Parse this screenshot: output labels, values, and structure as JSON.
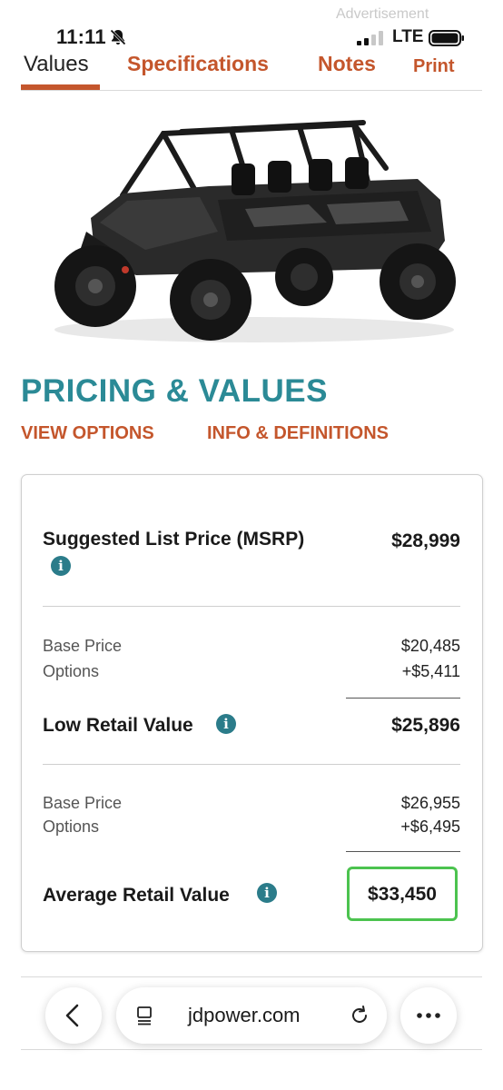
{
  "status_bar": {
    "advertisement": "Advertisement",
    "time": "11:11",
    "carrier": "LTE"
  },
  "tabs": [
    {
      "label": "Values",
      "active": true
    },
    {
      "label": "Specifications"
    },
    {
      "label": "Notes"
    },
    {
      "label": "Print"
    }
  ],
  "section_title": "PRICING & VALUES",
  "links": {
    "view_options": "VIEW OPTIONS",
    "info_definitions": "INFO & DEFINITIONS"
  },
  "pricing": {
    "msrp": {
      "label": "Suggested List Price (MSRP)",
      "value": "$28,999"
    },
    "low": {
      "base_label": "Base Price",
      "base_value": "$20,485",
      "options_label": "Options",
      "options_value": "+$5,411",
      "label": "Low Retail Value",
      "value": "$25,896"
    },
    "average": {
      "base_label": "Base Price",
      "base_value": "$26,955",
      "options_label": "Options",
      "options_value": "+$6,495",
      "label": "Average Retail Value",
      "value": "$33,450"
    }
  },
  "info_icon_glyph": "i",
  "browser": {
    "url": "jdpower.com",
    "icons": [
      "back-arrow-icon",
      "tabs-icon",
      "reload-icon",
      "more-icon"
    ]
  },
  "colors": {
    "accent_orange": "#c4562c",
    "title_teal": "#2b8a96",
    "info_teal": "#2b7c8a",
    "highlight_green": "#4cc34f"
  }
}
